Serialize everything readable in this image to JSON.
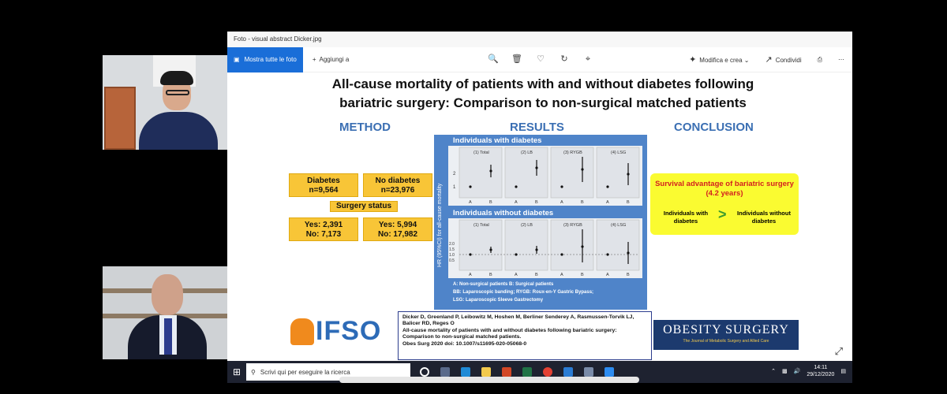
{
  "window": {
    "title": "Foto - visual abstract Dicker.jpg"
  },
  "toolbar": {
    "all_photos": "Mostra tutte le foto",
    "add": "Aggiungi a",
    "edit": "Modifica e crea",
    "share": "Condividi",
    "icons": [
      "zoom-icon",
      "delete-icon",
      "favorite-icon",
      "rotate-icon",
      "crop-icon"
    ]
  },
  "slide": {
    "title_line1": "All-cause mortality of patients with and without diabetes following",
    "title_line2": "bariatric surgery: Comparison to non-surgical matched patients",
    "method_heading": "METHOD",
    "results_heading": "RESULTS",
    "conclusion_heading": "CONCLUSION",
    "method": {
      "diabetes_title": "Diabetes",
      "diabetes_n": "n=9,564",
      "nodiabetes_title": "No diabetes",
      "nodiabetes_n": "n=23,976",
      "surgery_status": "Surgery status",
      "diab_yes": "Yes: 2,391",
      "diab_no": "No: 7,173",
      "nodiab_yes": "Yes: 5,994",
      "nodiab_no": "No: 17,982"
    },
    "results": {
      "panel1_title": "Individuals with diabetes",
      "panel2_title": "Individuals without diabetes",
      "y_axis_label": "HR (95%CI) for all-cause mortality",
      "subplots": [
        "(1) Total",
        "(2) LB",
        "(3) RYGB",
        "(4) LSG"
      ],
      "panel1_yticks": [
        "2",
        "1"
      ],
      "panel2_yticks": [
        "2.0",
        "1.5",
        "1.0",
        "0.5"
      ],
      "xticks": [
        "A",
        "B"
      ],
      "legend_line1": "A: Non-surgical patients B: Surgical patients",
      "legend_line2": "BB: Laparoscopic banding;  RYGB: Roux-en-Y Gastric Bypass;",
      "legend_line3": "LSG: Laparoscopic Sleeve Gastrectomy"
    },
    "conclusion": {
      "headline": "Survival advantage of bariatric surgery (4.2 years)",
      "left": "Individuals with diabetes",
      "arrow": ">",
      "right": "Individuals without diabetes"
    },
    "logo_ifso": "IFSO",
    "citation": {
      "authors": "Dicker D, Greenland P, Leibowitz M, Hoshen M, Berliner Senderey A, Rasmussen-Torvik LJ, Balicer RD, Reges O",
      "title": "All-cause mortality of patients with and without diabetes following bariatric surgery: Comparison to non-surgical matched patients.",
      "ref": "Obes Surg 2020 doi: 10.1007/s11695-020-05068-0"
    },
    "journal": {
      "name": "OBESITY SURGERY",
      "subtitle": "The Journal of Metabolic Surgery and Allied Care"
    }
  },
  "taskbar": {
    "search_placeholder": "Scrivi qui per eseguire la ricerca",
    "time": "14:11",
    "date": "29/12/2020"
  }
}
